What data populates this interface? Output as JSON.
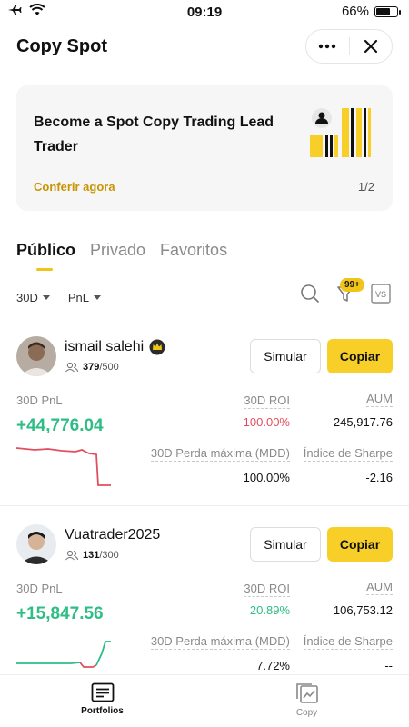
{
  "status_bar": {
    "time": "09:19",
    "battery": "66%",
    "battery_level": 0.66
  },
  "header": {
    "title": "Copy Spot",
    "more_icon": "ellipsis-icon",
    "close_icon": "close-icon"
  },
  "banner": {
    "text": "Become a Spot Copy Trading Lead Trader",
    "link": "Conferir agora",
    "page": "1/2"
  },
  "tabs": [
    "Público",
    "Privado",
    "Favoritos"
  ],
  "filters": {
    "period": "30D",
    "metric": "PnL",
    "badge": "99+"
  },
  "traders": [
    {
      "name": "ismail salehi",
      "followers": "379",
      "followers_max": "/500",
      "simulate": "Simular",
      "copy": "Copiar",
      "pnl_label": "30D PnL",
      "pnl": "+44,776.04",
      "roi_label": "30D  ROI",
      "roi": "-100.00%",
      "aum_label": "AUM",
      "aum": "245,917.76",
      "mdd_label": "30D Perda máxima (MDD)",
      "mdd": "100.00%",
      "sharpe_label": "Índice de Sharpe",
      "sharpe": "-2.16",
      "trend": "down"
    },
    {
      "name": "Vuatrader2025",
      "followers": "131",
      "followers_max": "/300",
      "simulate": "Simular",
      "copy": "Copiar",
      "pnl_label": "30D PnL",
      "pnl": "+15,847.56",
      "roi_label": "30D  ROI",
      "roi": "20.89%",
      "aum_label": "AUM",
      "aum": "106,753.12",
      "mdd_label": "30D Perda máxima (MDD)",
      "mdd": "7.72%",
      "sharpe_label": "Índice de Sharpe",
      "sharpe": "--",
      "trend": "up"
    }
  ],
  "bottom_nav": [
    {
      "label": "Portfolios",
      "icon": "portfolio-list-icon",
      "active": true
    },
    {
      "label": "Copy",
      "icon": "copy-chart-icon",
      "active": false
    }
  ],
  "colors": {
    "accent": "#f7cf28",
    "positive": "#2ebd85",
    "negative": "#e04f5f"
  }
}
